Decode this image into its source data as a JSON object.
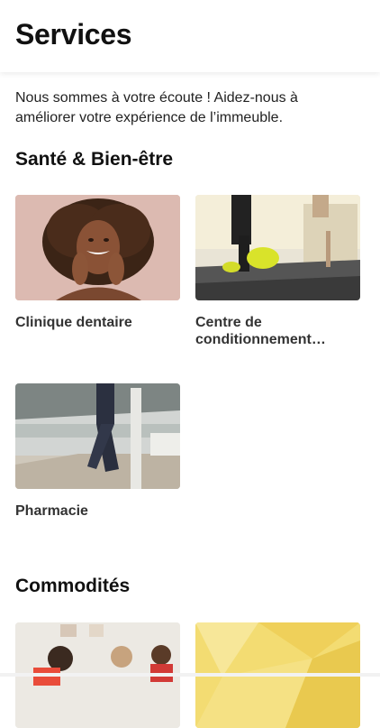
{
  "header": {
    "title": "Services"
  },
  "intro": "Nous sommes à votre écoute ! Aidez-nous à améliorer votre expérience de l’immeuble.",
  "sections": [
    {
      "title": "Santé & Bien-être",
      "items": [
        {
          "label": "Clinique dentaire"
        },
        {
          "label": "Centre de conditionnement physique"
        },
        {
          "label": "Pharmacie"
        }
      ]
    },
    {
      "title": "Commodités",
      "items": []
    }
  ],
  "colors": {
    "background": "#ffffff",
    "text": "#111111",
    "label": "#333333",
    "accent_yellow": "#f2d86a"
  }
}
